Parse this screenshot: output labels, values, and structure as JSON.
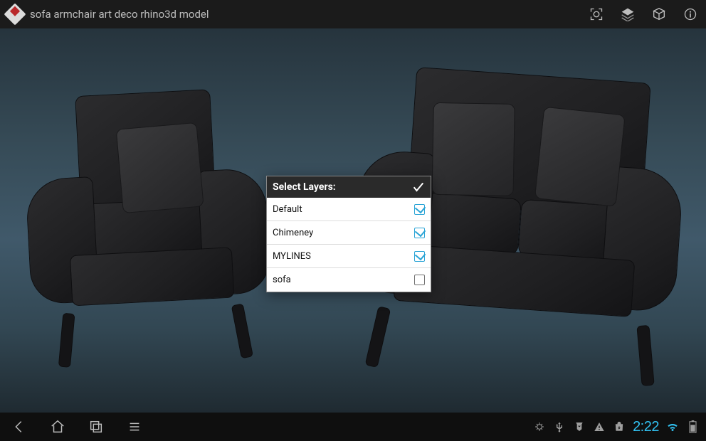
{
  "titlebar": {
    "title": "sofa armchair art deco rhino3d model",
    "icons": [
      "fit-view",
      "layers",
      "orbit",
      "info"
    ]
  },
  "dialog": {
    "heading": "Select Layers:",
    "confirm_icon": "check",
    "items": [
      {
        "label": "Default",
        "checked": true
      },
      {
        "label": "Chimeney",
        "checked": true
      },
      {
        "label": "MYLINES",
        "checked": true
      },
      {
        "label": "sofa",
        "checked": false
      }
    ]
  },
  "navbar": {
    "buttons": [
      "back",
      "home",
      "recent",
      "menu"
    ],
    "status": {
      "icons": [
        "debug",
        "usb",
        "download",
        "warning",
        "store"
      ],
      "clock": "2:22",
      "wifi": true,
      "battery": true
    }
  }
}
